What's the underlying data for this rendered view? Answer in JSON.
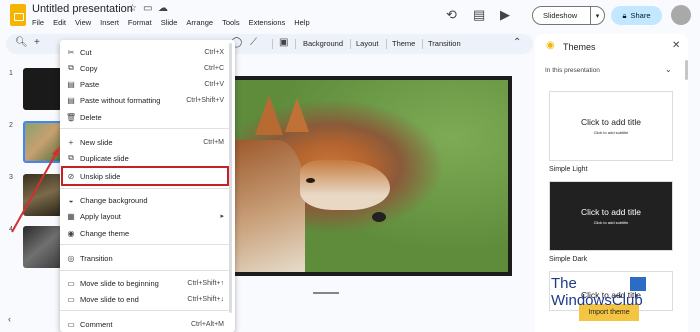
{
  "app": {
    "title": "Untitled presentation",
    "menu": [
      "File",
      "Edit",
      "View",
      "Insert",
      "Format",
      "Slide",
      "Arrange",
      "Tools",
      "Extensions",
      "Help"
    ]
  },
  "header": {
    "slideshow_label": "Slideshow",
    "share_label": "Share"
  },
  "toolbar": {
    "background_label": "Background",
    "layout_label": "Layout",
    "theme_label": "Theme",
    "transition_label": "Transition"
  },
  "filmstrip": {
    "slide_numbers": [
      "1",
      "2",
      "3",
      "4"
    ]
  },
  "context_menu": {
    "items": [
      {
        "icon": "cut-icon",
        "label": "Cut",
        "shortcut": "Ctrl+X"
      },
      {
        "icon": "copy-icon",
        "label": "Copy",
        "shortcut": "Ctrl+C"
      },
      {
        "icon": "paste-icon",
        "label": "Paste",
        "shortcut": "Ctrl+V"
      },
      {
        "icon": "paste-plain-icon",
        "label": "Paste without formatting",
        "shortcut": "Ctrl+Shift+V"
      },
      {
        "icon": "delete-icon",
        "label": "Delete",
        "shortcut": ""
      },
      {
        "icon": "plus-icon",
        "label": "New slide",
        "shortcut": "Ctrl+M"
      },
      {
        "icon": "duplicate-icon",
        "label": "Duplicate slide",
        "shortcut": ""
      },
      {
        "icon": "eye-slash-icon",
        "label": "Unskip slide",
        "shortcut": ""
      },
      {
        "icon": "background-icon",
        "label": "Change background",
        "shortcut": ""
      },
      {
        "icon": "layout-icon",
        "label": "Apply layout",
        "shortcut": "▸"
      },
      {
        "icon": "palette-icon",
        "label": "Change theme",
        "shortcut": ""
      },
      {
        "icon": "transition-icon",
        "label": "Transition",
        "shortcut": ""
      },
      {
        "icon": "move-start-icon",
        "label": "Move slide to beginning",
        "shortcut": "Ctrl+Shift+↑"
      },
      {
        "icon": "move-end-icon",
        "label": "Move slide to end",
        "shortcut": "Ctrl+Shift+↓"
      },
      {
        "icon": "comment-icon",
        "label": "Comment",
        "shortcut": "Ctrl+Alt+M"
      }
    ]
  },
  "themes": {
    "panel_title": "Themes",
    "dropdown_label": "In this presentation",
    "cards": [
      {
        "name": "Simple Light",
        "title": "Click to add title",
        "subtitle": "Click to add subtitle",
        "bg": "#ffffff",
        "fg": "#1f1f1f"
      },
      {
        "name": "Simple Dark",
        "title": "Click to add title",
        "subtitle": "Click to add subtitle",
        "bg": "#212121",
        "fg": "#ffffff"
      },
      {
        "name": "",
        "title": "Click to add title",
        "subtitle": "",
        "bg": "#ffffff",
        "fg": "#1f1f1f"
      }
    ],
    "import_label": "Import theme"
  },
  "watermark": {
    "line1": "The",
    "line2": "WindowsClub"
  },
  "colors": {
    "accent": "#c2e7ff",
    "highlight": "#c8202b",
    "logo": "#f4b400"
  }
}
